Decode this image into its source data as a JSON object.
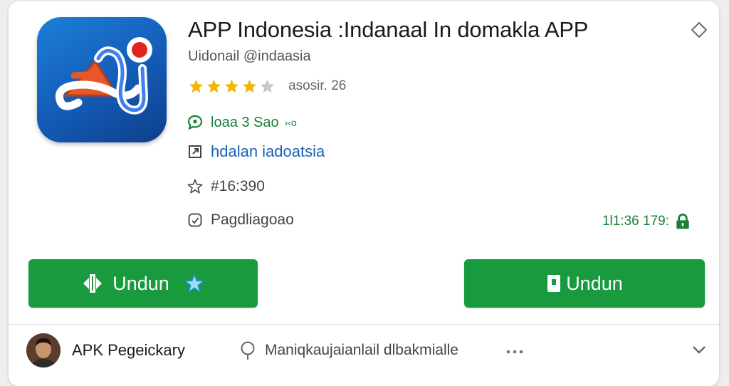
{
  "app": {
    "title": "APP Indonesia :Indanaal In domakla APP",
    "developer": "Uidonail @indaasia",
    "rating_text": "asosir. 26",
    "stars_filled": 4,
    "stars_total": 5
  },
  "meta": {
    "downloads": "loaa 3 Sao",
    "downloads_sub": "›‹o",
    "category": "hdalan iadoatsia",
    "version": "#16:390",
    "updated": "Pagdliagoao",
    "file_size": "1l1:36 179:"
  },
  "buttons": {
    "left_label": "Undun",
    "right_label": "Undun"
  },
  "footer": {
    "uploader": "APK Pegeickary",
    "comment": "Maniqkaujaianlail dlbakmialle",
    "more": "•••"
  },
  "colors": {
    "accent": "#1a9a3e",
    "link": "#1a5fb4",
    "star": "#f5b400",
    "icon_bg": "#135bb6"
  },
  "icons": {
    "menu": "diamond-icon",
    "downloads": "chat-bubble-icon",
    "category": "external-link-icon",
    "version": "star-outline-icon",
    "updated": "clock-icon",
    "file_size": "lock-icon"
  }
}
